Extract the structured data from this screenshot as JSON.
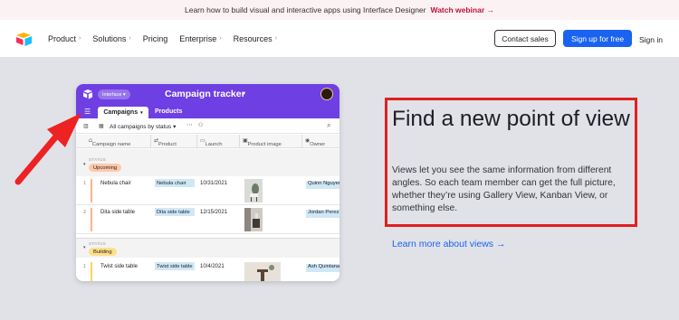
{
  "banner": {
    "text": "Learn how to build visual and interactive apps using Interface Designer",
    "link": "Watch webinar →"
  },
  "nav": {
    "items": [
      {
        "label": "Product",
        "chevron": "›"
      },
      {
        "label": "Solutions",
        "chevron": "›"
      },
      {
        "label": "Pricing",
        "chevron": ""
      },
      {
        "label": "Enterprise",
        "chevron": "›"
      },
      {
        "label": "Resources",
        "chevron": "›"
      }
    ],
    "contact_sales": "Contact sales",
    "sign_up": "Sign up for free",
    "sign_in": "Sign in"
  },
  "app": {
    "interface_pill": "Interface ▾",
    "title": "Campaign tracker",
    "title_chevron": "▾",
    "tabs": [
      {
        "label": "Campaigns",
        "chevron": "▾"
      },
      {
        "label": "Products"
      }
    ],
    "view_name": "All campaigns by status ▾",
    "columns": [
      "Campaign name",
      "Product",
      "Launch",
      "Product image",
      "Owner"
    ],
    "groups": [
      {
        "label": "STATUS",
        "status": "Upcoming",
        "rows": [
          {
            "num": "1",
            "name": "Nebula chair",
            "product": "Nebula chair",
            "launch": "10/31/2021",
            "owner": "Quinn Nguyen"
          },
          {
            "num": "2",
            "name": "Dita side table",
            "product": "Dita side table",
            "launch": "12/15/2021",
            "owner": "Jordan Perez"
          }
        ]
      },
      {
        "label": "STATUS",
        "status": "Building",
        "rows": [
          {
            "num": "1",
            "name": "Twist side table",
            "product": "Twist side table",
            "launch": "10/4/2021",
            "owner": "Ash Quintana"
          }
        ]
      }
    ]
  },
  "feature": {
    "headline": "Find a new point of view",
    "description": "Views let you see the same information from different angles. So each team member can get the full picture, whether they’re using Gallery View, Kanban View, or something else.",
    "link": "Learn more about views →"
  },
  "colors": {
    "accent": "#1a63f0",
    "app_header": "#6e3fe3",
    "annotation": "#e02020"
  }
}
